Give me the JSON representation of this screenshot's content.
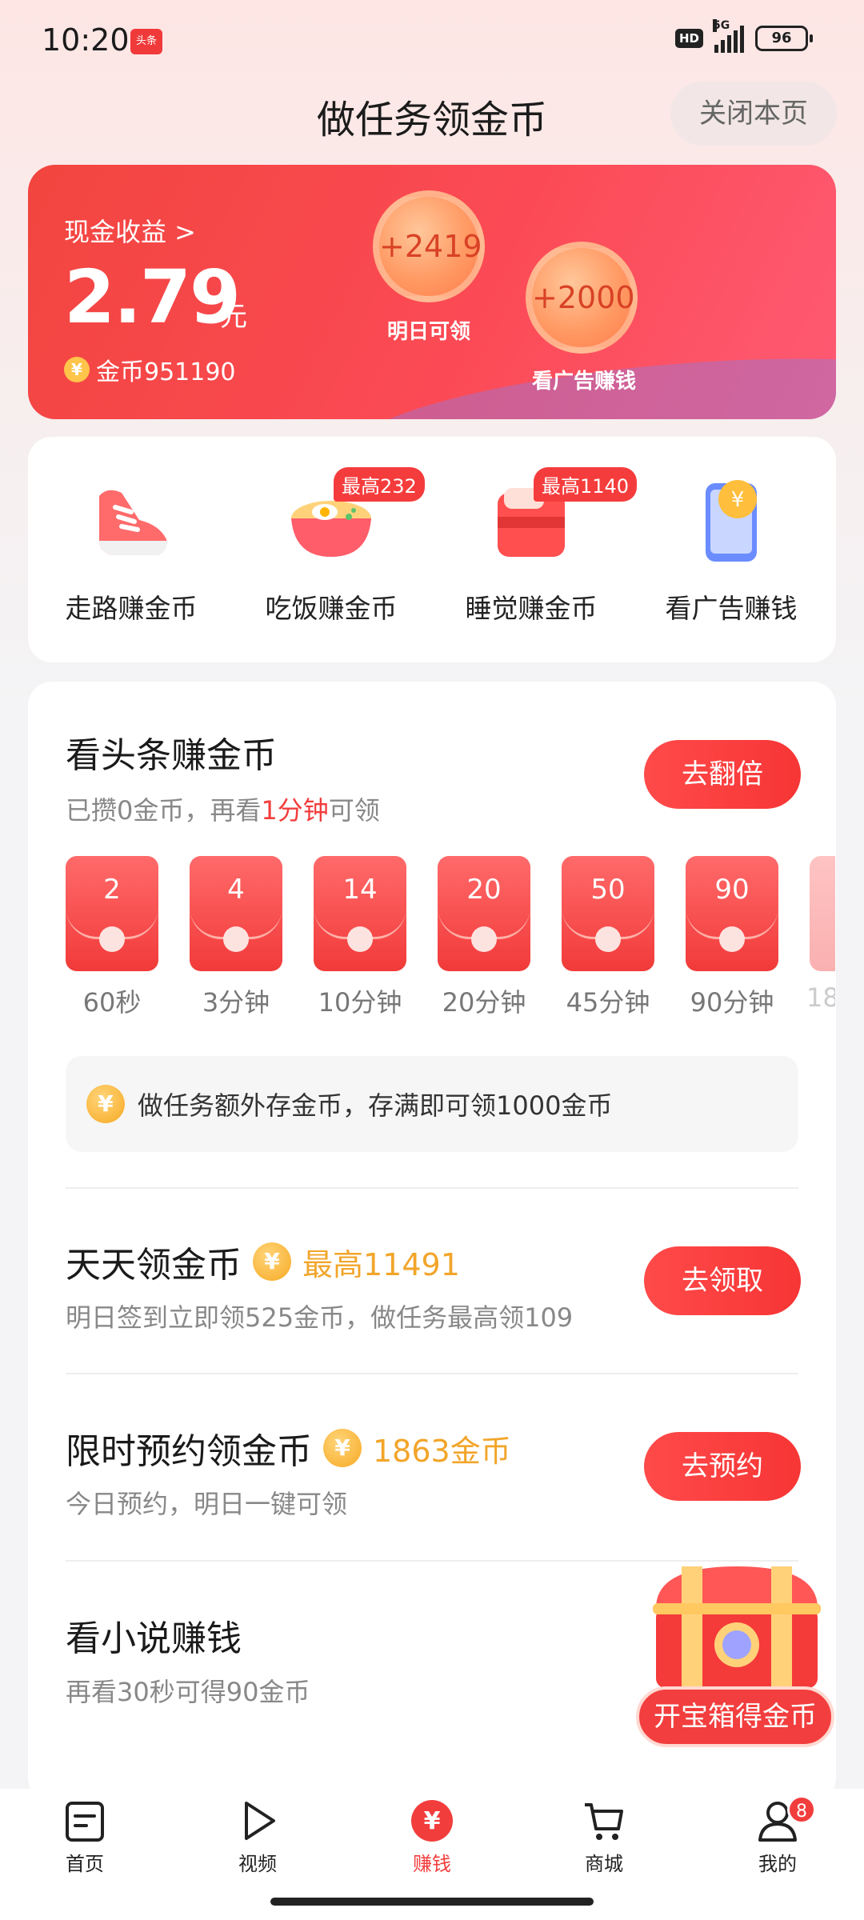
{
  "status_bar": {
    "time": "10:20",
    "app_badge": "头条",
    "hd": "HD",
    "network": "5G",
    "battery": "96"
  },
  "header": {
    "title": "做任务领金币",
    "close_label": "关闭本页"
  },
  "earnings": {
    "cash_label": "现金收益 >",
    "cash_amount": "2.79",
    "cash_unit": "元",
    "coin_label": "金币951190",
    "bubble1_value": "+2419",
    "bubble1_label": "明日可领",
    "bubble2_value": "+2000",
    "bubble2_label": "看广告赚钱"
  },
  "quick_tasks": [
    {
      "label": "走路赚金币",
      "tag": ""
    },
    {
      "label": "吃饭赚金币",
      "tag": "最高232"
    },
    {
      "label": "睡觉赚金币",
      "tag": "最高1140"
    },
    {
      "label": "看广告赚钱",
      "tag": ""
    }
  ],
  "read_task": {
    "title": "看头条赚金币",
    "sub_prefix": "已攒0金币，再看",
    "sub_highlight": "1分钟",
    "sub_suffix": "可领",
    "button": "去翻倍",
    "envelopes": [
      {
        "value": "2",
        "label": "60秒"
      },
      {
        "value": "4",
        "label": "3分钟"
      },
      {
        "value": "14",
        "label": "10分钟"
      },
      {
        "value": "20",
        "label": "20分钟"
      },
      {
        "value": "50",
        "label": "45分钟"
      },
      {
        "value": "90",
        "label": "90分钟"
      },
      {
        "value": "",
        "label": "18"
      }
    ],
    "tip": "做任务额外存金币，存满即可领1000金币"
  },
  "daily_task": {
    "title": "天天领金币",
    "highlight": "最高11491",
    "sub": "明日签到立即领525金币，做任务最高领109",
    "button": "去领取"
  },
  "reserve_task": {
    "title": "限时预约领金币",
    "highlight": "1863金币",
    "sub": "今日预约，明日一键可领",
    "button": "去预约"
  },
  "novel_task": {
    "title": "看小说赚钱",
    "sub": "再看30秒可得90金币"
  },
  "treasure": {
    "label": "开宝箱得金币"
  },
  "bottom_nav": [
    {
      "label": "首页",
      "active": false
    },
    {
      "label": "视频",
      "active": false
    },
    {
      "label": "赚钱",
      "active": true
    },
    {
      "label": "商城",
      "active": false
    },
    {
      "label": "我的",
      "active": false,
      "badge": "8"
    }
  ],
  "colors": {
    "accent": "#f53c3c",
    "gold": "#f2a52a"
  }
}
